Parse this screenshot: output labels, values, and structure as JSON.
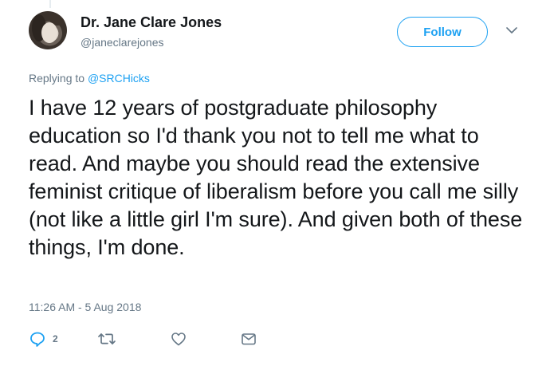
{
  "author": {
    "name": "Dr. Jane Clare Jones",
    "handle": "@janeclarejones"
  },
  "follow_label": "Follow",
  "reply_context": {
    "prefix": "Replying to",
    "mention": "@SRCHicks"
  },
  "tweet_text": "I have 12 years of postgraduate philosophy education so I'd thank you not to tell me what to read. And maybe you should read the extensive feminist critique of liberalism before you call me silly (not like a little girl I'm sure). And given both of these things, I'm done.",
  "timestamp": "11:26 AM - 5 Aug 2018",
  "actions": {
    "reply_count": "2"
  },
  "colors": {
    "accent": "#1da1f2",
    "secondary_text": "#657786",
    "primary_text": "#14171a"
  },
  "icons": [
    "chevron-down-icon",
    "reply-icon",
    "retweet-icon",
    "like-icon",
    "direct-message-icon"
  ]
}
